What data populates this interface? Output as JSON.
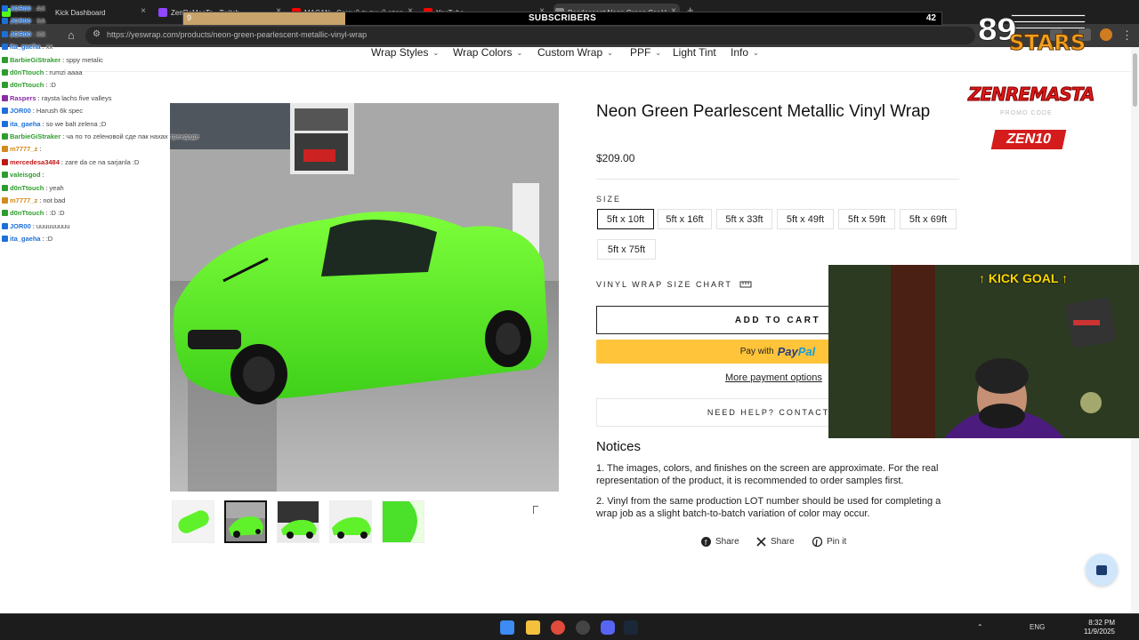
{
  "browser": {
    "tabs": [
      {
        "label": "JOR00 : AX",
        "close": "×"
      },
      {
        "label": "ZenReMasTa - Twitch",
        "close": "×"
      },
      {
        "label": "MACAN - Самый пьяный спар",
        "close": "×"
      },
      {
        "label": "YouTube",
        "close": "×"
      },
      {
        "label": "Pearlescent Neon Green Car V",
        "close": "×"
      }
    ],
    "tab0_sub": "Kick Dashboard",
    "new_tab": "+",
    "url": "https://yeswrap.com/products/neon-green-pearlescent-metallic-vinyl-wrap"
  },
  "subscribers": {
    "title": "SUBSCRIBERS",
    "current": "9",
    "goal": "42",
    "progress": 0.214
  },
  "chat": [
    {
      "user": "JOR00",
      "msg": "AX",
      "color": "#1e6fd9"
    },
    {
      "user": "JOR00",
      "msg": "XA",
      "color": "#1e6fd9"
    },
    {
      "user": "JOR00",
      "msg": "XX",
      "color": "#1e6fd9"
    },
    {
      "user": "ita_gaeha",
      "msg": "xx",
      "color": "#1e6fd9"
    },
    {
      "user": "BarbieGiStraker",
      "msg": "sppy metalic",
      "color": "#2e9c2e"
    },
    {
      "user": "d0nTtouch",
      "msg": "rumzi aaaa",
      "color": "#2e9c2e"
    },
    {
      "user": "d0nTtouch",
      "msg": ":D",
      "color": "#2e9c2e"
    },
    {
      "user": "Raspers",
      "msg": "raysta lachs five valleys",
      "color": "#8a2aa3"
    },
    {
      "user": "JOR00",
      "msg": "Harush 6k spec",
      "color": "#1e6fd9"
    },
    {
      "user": "ita_gaeha",
      "msg": "so we balt zelena ;D",
      "color": "#1e6fd9"
    },
    {
      "user": "BarbieGiStraker",
      "msg": "ча по тo zelеновой сде пак нахах трендаде",
      "color": "#2e9c2e"
    },
    {
      "user": "m7777_z",
      "msg": "",
      "color": "#d18a1c"
    },
    {
      "user": "mercedesa3484",
      "msg": "zare da ce na sarjanla :D",
      "color": "#c01717"
    },
    {
      "user": "valeisgod",
      "msg": "",
      "color": "#2e9c2e"
    },
    {
      "user": "d0nTtouch",
      "msg": "yeah",
      "color": "#2e9c2e"
    },
    {
      "user": "m7777_z",
      "msg": "not bad",
      "color": "#d18a1c"
    },
    {
      "user": "d0nTtouch",
      "msg": ":D :D",
      "color": "#2e9c2e"
    },
    {
      "user": "JOR00",
      "msg": "uuuuuuuuu",
      "color": "#1e6fd9"
    },
    {
      "user": "ita_gaeha",
      "msg": ":D",
      "color": "#1e6fd9"
    }
  ],
  "site": {
    "nav": [
      {
        "label": "Wrap Styles",
        "has_caret": true
      },
      {
        "label": "Wrap Colors",
        "has_caret": true
      },
      {
        "label": "Custom Wrap",
        "has_caret": true
      },
      {
        "label": "PPF",
        "has_caret": true
      },
      {
        "label": "Light Tint",
        "has_caret": false
      },
      {
        "label": "Info",
        "has_caret": true
      }
    ],
    "caret": "⌄",
    "product": {
      "title": "Neon Green Pearlescent Metallic Vinyl Wrap",
      "price": "$209.00",
      "size_label": "SIZE",
      "sizes": [
        "5ft x 10ft",
        "5ft x 16ft",
        "5ft x 33ft",
        "5ft x 49ft",
        "5ft x 59ft",
        "5ft x 69ft",
        "5ft x 75ft"
      ],
      "selected_size": "5ft x 10ft",
      "size_chart": "VINYL WRAP SIZE CHART",
      "add_to_cart": "ADD TO CART",
      "paypal_prefix": "Pay with",
      "paypal_brand_a": "Pay",
      "paypal_brand_b": "Pal",
      "more_payment": "More payment options",
      "need_help": "NEED HELP? CONTACT US",
      "notices_heading": "Notices",
      "notices": [
        "1. The images, colors, and finishes on the screen are approximate. For the real representation of the product, it is recommended to order samples first.",
        "2. Vinyl from the same production LOT number should be used for completing a wrap job as a slight batch-to-batch variation of color may occur."
      ],
      "share": [
        {
          "label": "Share",
          "icon": "facebook-icon"
        },
        {
          "label": "Share",
          "icon": "x-twitter-icon"
        },
        {
          "label": "Pin it",
          "icon": "pinterest-icon"
        }
      ]
    }
  },
  "overlay": {
    "stars_num": "89",
    "stars_word": "STARS",
    "zen_word": "ZENREMASTA",
    "zen_promo": "PROMO CODE",
    "zen_code": "ZEN10",
    "goal_text": "↑ KICK GOAL ↑"
  },
  "taskbar": {
    "lang": "ENG",
    "time": "8:32 PM",
    "date": "11/9/2025"
  },
  "colors": {
    "accent_green": "#5ff22a",
    "paypal_yellow": "#ffc43a",
    "subscriber_fill": "#c8a36b"
  }
}
